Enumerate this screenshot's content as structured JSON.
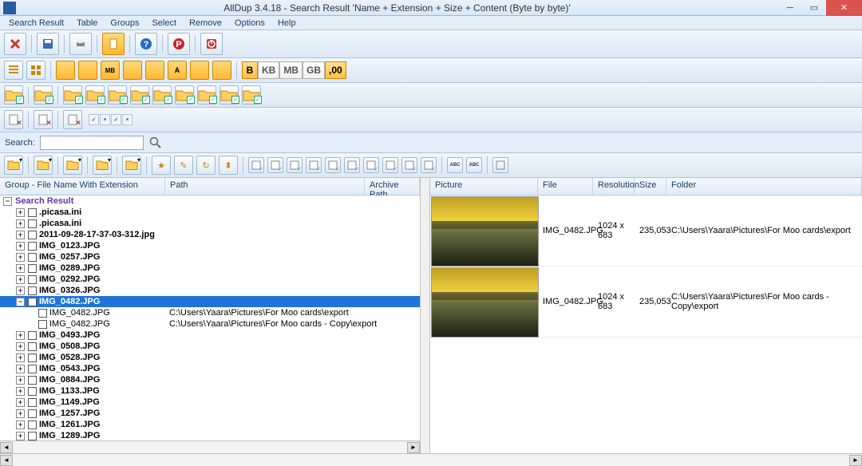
{
  "title": "AllDup 3.4.18 - Search Result 'Name + Extension + Size + Content (Byte by byte)'",
  "menu": [
    "Search Result",
    "Table",
    "Groups",
    "Select",
    "Remove",
    "Options",
    "Help"
  ],
  "sizeBtns": [
    "B",
    "KB",
    "MB",
    "GB",
    ",00"
  ],
  "search": {
    "label": "Search:",
    "value": ""
  },
  "leftCols": {
    "group": "Group - File Name With Extension",
    "path": "Path",
    "archive": "Archive Path"
  },
  "rightCols": {
    "picture": "Picture",
    "file": "File",
    "resolution": "Resolution",
    "size": "Size",
    "folder": "Folder"
  },
  "tree": {
    "root": "Search Result",
    "groups": [
      {
        "name": ".picasa.ini",
        "expanded": false
      },
      {
        "name": ".picasa.ini",
        "expanded": false
      },
      {
        "name": "2011-09-28-17-37-03-312.jpg",
        "expanded": false
      },
      {
        "name": "IMG_0123.JPG",
        "expanded": false
      },
      {
        "name": "IMG_0257.JPG",
        "expanded": false
      },
      {
        "name": "IMG_0289.JPG",
        "expanded": false
      },
      {
        "name": "IMG_0292.JPG",
        "expanded": false
      },
      {
        "name": "IMG_0326.JPG",
        "expanded": false
      },
      {
        "name": "IMG_0482.JPG",
        "expanded": true,
        "selected": true,
        "children": [
          {
            "name": "IMG_0482.JPG",
            "path": "C:\\Users\\Yaara\\Pictures\\For Moo cards\\export"
          },
          {
            "name": "IMG_0482.JPG",
            "path": "C:\\Users\\Yaara\\Pictures\\For Moo cards - Copy\\export"
          }
        ]
      },
      {
        "name": "IMG_0493.JPG",
        "expanded": false
      },
      {
        "name": "IMG_0508.JPG",
        "expanded": false
      },
      {
        "name": "IMG_0528.JPG",
        "expanded": false
      },
      {
        "name": "IMG_0543.JPG",
        "expanded": false
      },
      {
        "name": "IMG_0884.JPG",
        "expanded": false
      },
      {
        "name": "IMG_1133.JPG",
        "expanded": false
      },
      {
        "name": "IMG_1149.JPG",
        "expanded": false
      },
      {
        "name": "IMG_1257.JPG",
        "expanded": false
      },
      {
        "name": "IMG_1261.JPG",
        "expanded": false
      },
      {
        "name": "IMG_1289.JPG",
        "expanded": false
      }
    ]
  },
  "preview": [
    {
      "file": "IMG_0482.JPG",
      "resolution": "1024 x 683",
      "size": "235,053",
      "folder": "C:\\Users\\Yaara\\Pictures\\For Moo cards\\export"
    },
    {
      "file": "IMG_0482.JPG",
      "resolution": "1024 x 683",
      "size": "235,053",
      "folder": "C:\\Users\\Yaara\\Pictures\\For Moo cards - Copy\\export"
    }
  ]
}
